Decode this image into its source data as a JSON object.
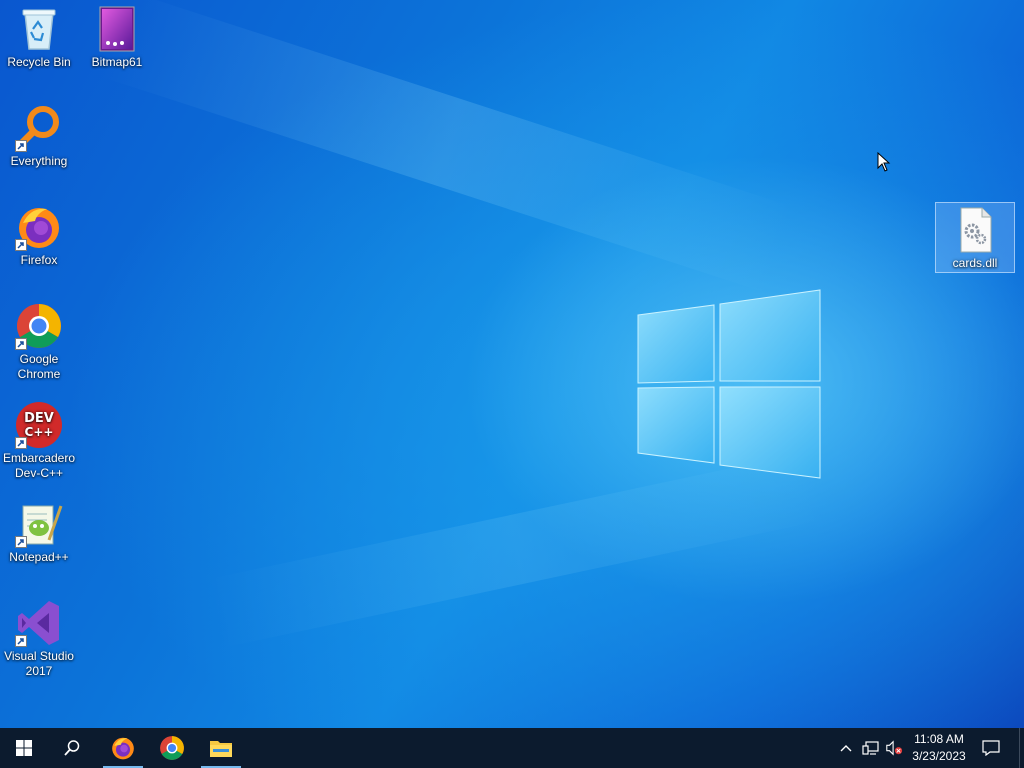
{
  "desktop": {
    "icons": [
      {
        "id": "recycle-bin",
        "label": "Recycle Bin"
      },
      {
        "id": "bitmap61",
        "label": "Bitmap61"
      },
      {
        "id": "everything",
        "label": "Everything"
      },
      {
        "id": "firefox",
        "label": "Firefox"
      },
      {
        "id": "google-chrome",
        "label": "Google Chrome"
      },
      {
        "id": "embarcadero-devcpp",
        "label": "Embarcadero Dev-C++"
      },
      {
        "id": "notepadpp",
        "label": "Notepad++"
      },
      {
        "id": "visual-studio",
        "label": "Visual Studio 2017"
      },
      {
        "id": "cards-dll",
        "label": "cards.dll",
        "selected": true
      }
    ]
  },
  "taskbar": {
    "buttons": [
      {
        "id": "start",
        "icon": "windows-logo-icon"
      },
      {
        "id": "search",
        "icon": "search-icon"
      },
      {
        "id": "firefox",
        "icon": "firefox-icon",
        "running": true
      },
      {
        "id": "chrome",
        "icon": "chrome-icon",
        "running": false
      },
      {
        "id": "file-explorer",
        "icon": "folder-icon",
        "running": true
      }
    ],
    "tray": {
      "icons": [
        "chevron-up-icon",
        "network-icon",
        "volume-muted-icon",
        "notification-icon"
      ],
      "time": "11:08 AM",
      "date": "3/23/2023"
    }
  },
  "colors": {
    "taskbar": "#0c1b2e",
    "desktop_accent": "#0c74d9",
    "active_indicator": "#76b9ed"
  }
}
